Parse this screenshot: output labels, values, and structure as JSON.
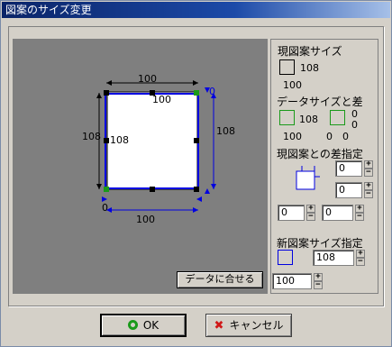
{
  "window": {
    "title": "図案のサイズ変更"
  },
  "canvas": {
    "top_width": "100",
    "top_inner": "100",
    "left_height": "108",
    "inner_height": "108",
    "right_height": "108",
    "bottom_width": "100",
    "right_small": "0",
    "bottom_small": "0",
    "fit_button_label": "データに合せる"
  },
  "panel": {
    "current_size_label": "現図案サイズ",
    "current_height": "108",
    "current_width": "100",
    "data_size_label": "データサイズと差",
    "data_height": "108",
    "data_width": "100",
    "diff_h": "0",
    "diff_w": "0",
    "diff_a": "0",
    "diff_b": "0",
    "diff_spec_label": "現図案との差指定",
    "diff_spec_top": "0",
    "diff_spec_right": "0",
    "diff_spec_left": "0",
    "diff_spec_bottom": "0",
    "new_size_label": "新図案サイズ指定",
    "new_height": "108",
    "new_width": "100"
  },
  "buttons": {
    "ok": "OK",
    "cancel": "キャンセル"
  },
  "colors": {
    "accent_blue": "#0000e0",
    "green": "#1a9a1a"
  }
}
